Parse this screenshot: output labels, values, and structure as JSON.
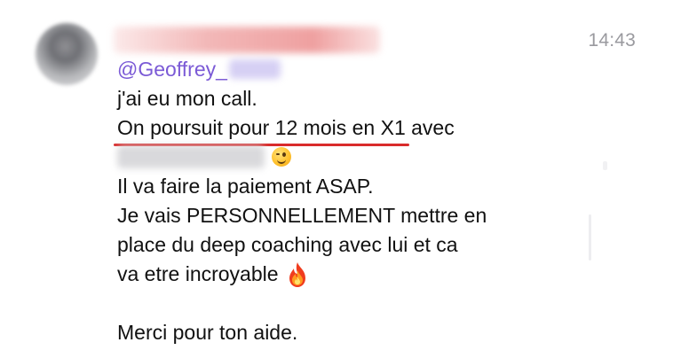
{
  "message": {
    "sender_name_redacted": "",
    "timestamp": "14:43",
    "mention_prefix": "@Geoffrey_",
    "lines": [
      "j'ai eu mon call.",
      "On poursuit pour 12 mois en X1",
      "avec",
      "Il va faire la paiement ASAP.",
      "Je vais PERSONNELLEMENT mettre en",
      "place du deep coaching avec lui et ca",
      "va etre incroyable",
      "Merci pour ton aide."
    ]
  },
  "icons": {
    "wink": "winking-face-emoji",
    "fire": "fire-emoji"
  },
  "colors": {
    "mention": "#7b5ad6",
    "underline": "#d92b2b",
    "timestamp": "#9a9a9f"
  }
}
